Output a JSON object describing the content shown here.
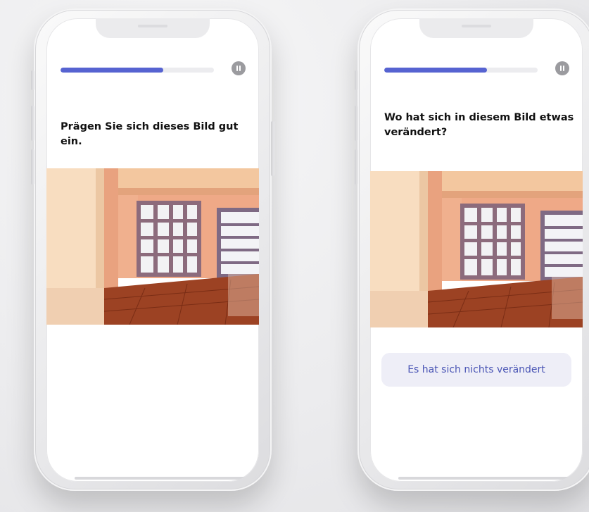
{
  "screens": [
    {
      "question": "Prägen Sie sich dieses Bild gut ein.",
      "progress": 0.67,
      "pause_icon": "pause-icon"
    },
    {
      "question": "Wo hat sich in diesem Bild etwas verändert?",
      "progress": 0.67,
      "pause_icon": "pause-icon",
      "answer_button": "Es hat sich nichts verändert"
    }
  ],
  "colors": {
    "accent": "#5663d1",
    "track": "#ececef",
    "pause_bg": "#9b9b9f",
    "answer_bg": "#eeeef7",
    "answer_text": "#4a55b5"
  }
}
